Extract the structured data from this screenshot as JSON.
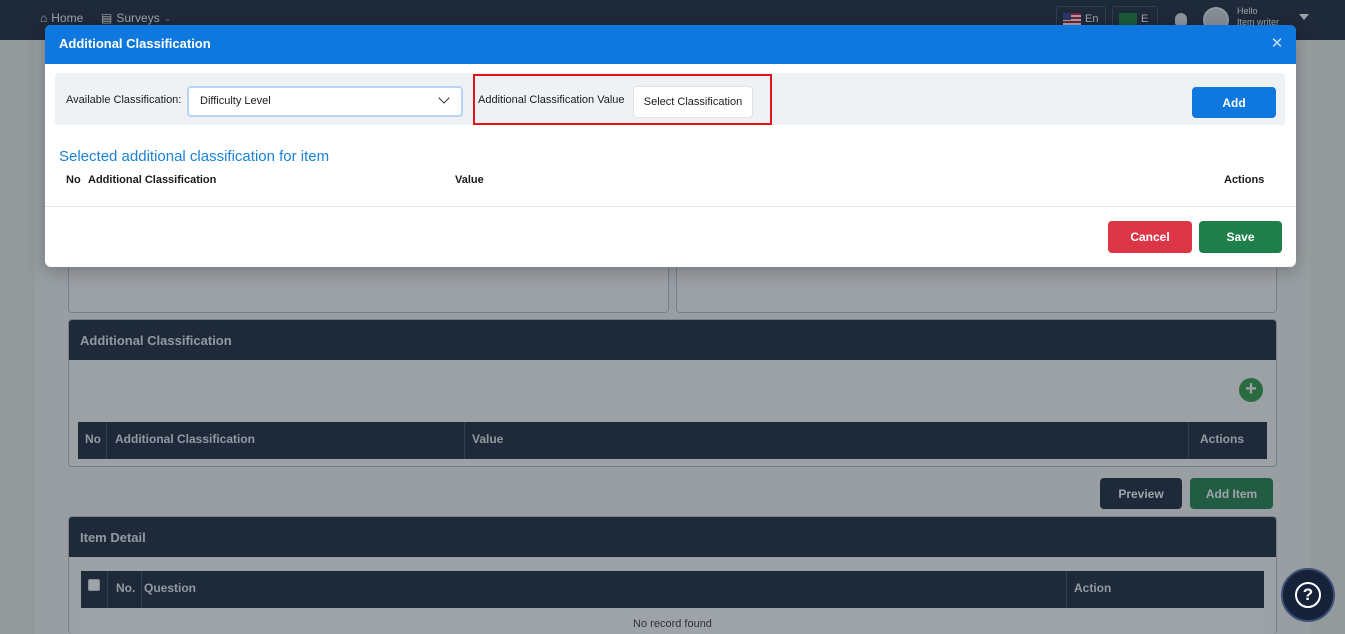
{
  "topnav": {
    "home_label": "Home",
    "surveys_label": "Surveys",
    "lang_en": "En",
    "lang_other": "E",
    "greeting": "Hello",
    "user_name": "Item writer"
  },
  "background": {
    "additional_classification": {
      "header": "Additional Classification",
      "columns": [
        "No",
        "Additional Classification",
        "Value",
        "Actions"
      ]
    },
    "buttons": {
      "preview": "Preview",
      "add_item": "Add Item"
    },
    "item_detail": {
      "header": "Item Detail",
      "columns": [
        "No.",
        "Question",
        "Action"
      ],
      "empty_text": "No record found"
    },
    "colors": {
      "navy": "#16213a",
      "green": "#1e7f4a"
    }
  },
  "modal": {
    "title": "Additional Classification",
    "available_label": "Available Classification:",
    "available_selected": "Difficulty Level",
    "value_label": "Additional Classification Value",
    "select_classification_button": "Select Classification",
    "add_button": "Add",
    "selected_title": "Selected additional classification for item",
    "columns": {
      "no": "No",
      "classification": "Additional Classification",
      "value": "Value",
      "actions": "Actions"
    },
    "cancel_button": "Cancel",
    "save_button": "Save",
    "colors": {
      "header": "#0f78de",
      "cancel": "#dc3545",
      "save": "#1e7f4a",
      "highlight": "#e2131a"
    }
  }
}
